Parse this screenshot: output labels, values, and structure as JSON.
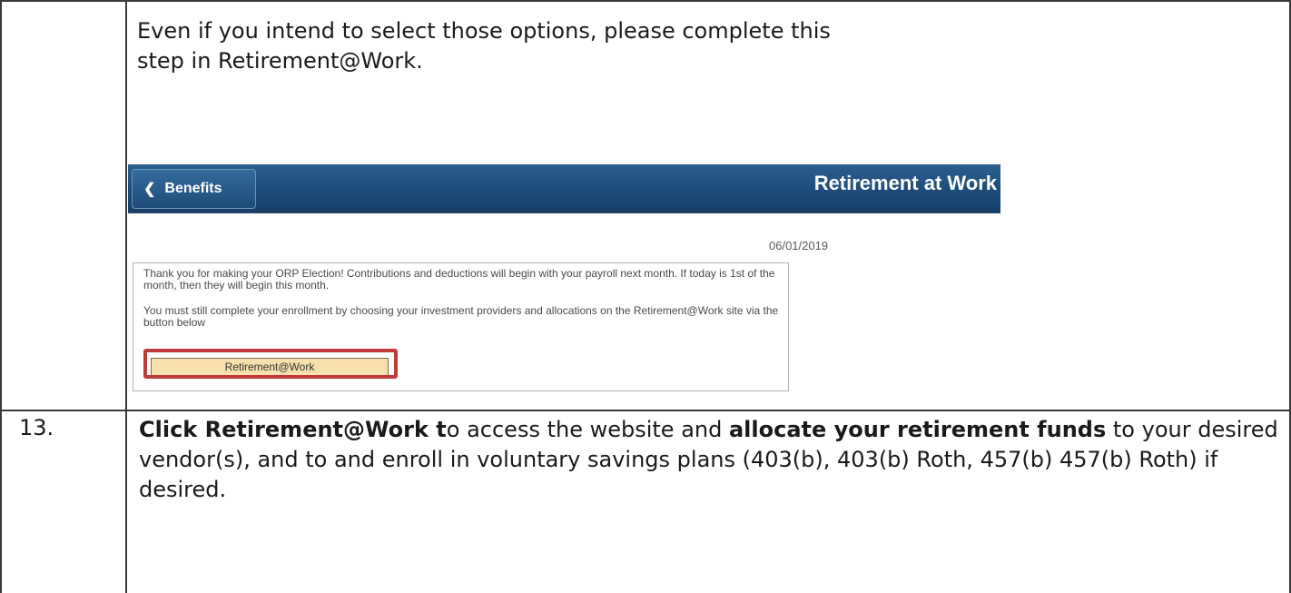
{
  "intro": {
    "text": "Even if you intend to select those options, please complete this step in Retirement@Work."
  },
  "screenshot": {
    "back_label": "Benefits",
    "page_title": "Retirement at Work",
    "date": "06/01/2019",
    "message_1": "Thank you for making your ORP Election! Contributions and deductions will begin with your payroll next month. If today is 1st of the month, then they will begin this month.",
    "message_2": "You must still complete your enrollment by choosing your investment providers and allocations on the Retirement@Work site via the button below",
    "button_label": "Retirement@Work",
    "highlight_color": "#bf3a3a",
    "nav_color": "#1c4a78"
  },
  "step": {
    "number": "13.",
    "part1_bold": "Click Retirement@Work t",
    "part2": "o access the website and ",
    "part3_bold": "allocate your retirement funds",
    "part4": " to your desired vendor(s), and to and enroll in voluntary savings plans (403(b), 403(b) Roth, 457(b) 457(b) Roth) if desired."
  }
}
